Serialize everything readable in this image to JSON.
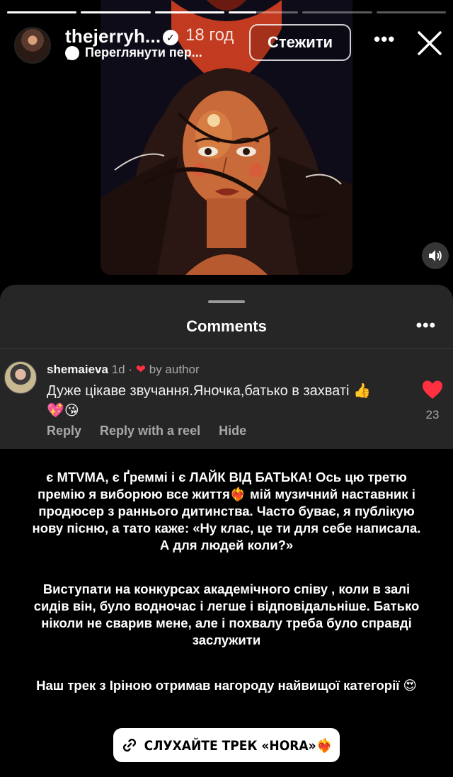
{
  "story": {
    "segments": [
      1,
      1,
      1,
      0.4,
      0,
      0
    ]
  },
  "header": {
    "username": "thejerryh...",
    "verified_mark": "✓",
    "time_ago": "18 год",
    "subtitle": "Переглянути пер...",
    "follow_label": "Стежити",
    "more_label": "•••"
  },
  "comments": {
    "title": "Comments",
    "more_label": "•••",
    "item": {
      "username": "shemaieva",
      "age": "1d",
      "separator": "·",
      "heart": "❤",
      "by_author": "by author",
      "text": "Дуже цікаве звучання.Яночка,батько в захваті 👍💖😘",
      "like_count": "23",
      "reply": "Reply",
      "reply_reel": "Reply with a reel",
      "hide": "Hide"
    }
  },
  "caption": {
    "p1": "є MTVMA, є Ґреммі і є ЛАЙК ВІД БАТЬКА! Ось цю третю премію я виборюю все життя❤️‍🔥 мій музичний наставник і продюсер з раннього дитинства. Часто буває, я публікую нову пісню, а тато каже: «Ну клас, це ти для себе написала. А для людей коли?»",
    "p2": "Виступати на конкурсах академічного співу , коли в залі сидів він, було водночас і легше і відповідальніше. Батько ніколи не сварив мене, але і похвалу треба було справді заслужити",
    "p3": "Наш трек з Іріною отримав нагороду найвищої категорії 😍"
  },
  "link_sticker": {
    "label": "СЛУХАЙТЕ ТРЕК «HORA»❤️‍🔥"
  },
  "colors": {
    "background": "#000000",
    "sheet": "#262626",
    "like_red": "#ff3040",
    "muted_text": "#a8a8a8"
  }
}
